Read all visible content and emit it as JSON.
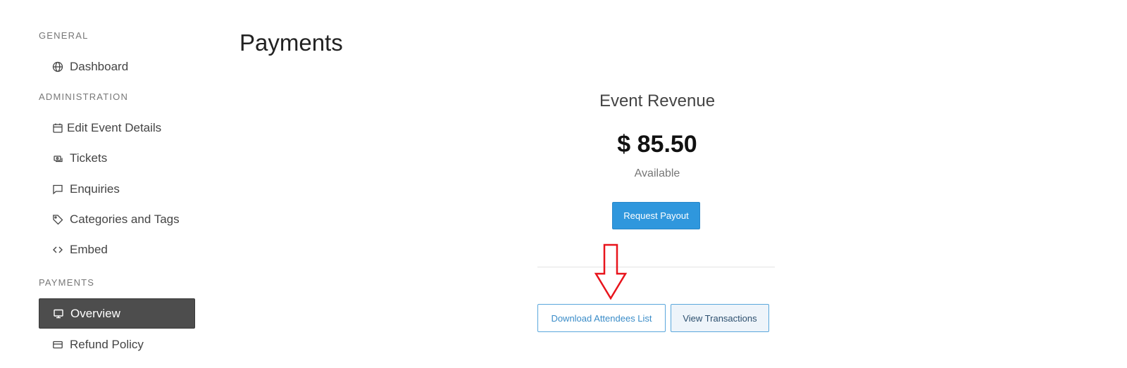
{
  "sidebar": {
    "general_title": "GENERAL",
    "general_items": [
      {
        "label": "Dashboard",
        "icon": "globe-icon"
      }
    ],
    "admin_title": "ADMINISTRATION",
    "admin_items": [
      {
        "label": "Edit Event Details",
        "icon": "calendar-icon"
      },
      {
        "label": "Tickets",
        "icon": "ticket-icon"
      },
      {
        "label": "Enquiries",
        "icon": "chat-icon"
      },
      {
        "label": "Categories and Tags",
        "icon": "tag-icon"
      },
      {
        "label": "Embed",
        "icon": "code-icon"
      }
    ],
    "payments_title": "PAYMENTS",
    "payments_items": [
      {
        "label": "Overview",
        "icon": "monitor-icon",
        "active": true
      },
      {
        "label": "Refund Policy",
        "icon": "credit-card-icon"
      }
    ]
  },
  "main": {
    "title": "Payments",
    "revenue": {
      "title": "Event Revenue",
      "amount": "$ 85.50",
      "status": "Available"
    },
    "request_payout_label": "Request Payout",
    "download_attendees_label": "Download Attendees List",
    "view_transactions_label": "View Transactions"
  },
  "colors": {
    "primary": "#2f97dd",
    "active_nav": "#4d4d4d",
    "annotation_arrow": "#e8141c"
  }
}
